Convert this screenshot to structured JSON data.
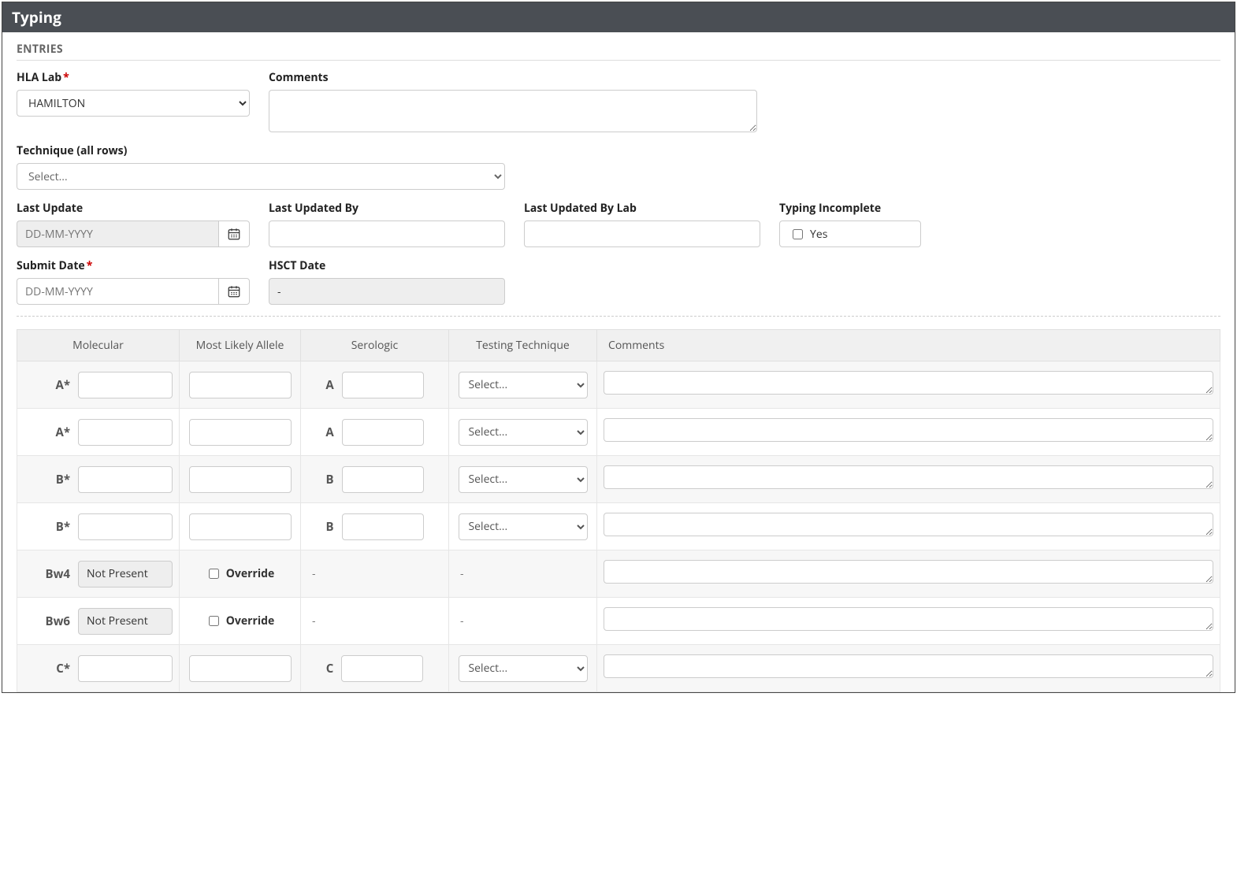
{
  "header": {
    "title": "Typing"
  },
  "section": {
    "entries": "ENTRIES"
  },
  "fields": {
    "hla_lab": {
      "label": "HLA Lab",
      "required": true,
      "value": "HAMILTON"
    },
    "comments": {
      "label": "Comments",
      "value": ""
    },
    "technique": {
      "label": "Technique (all rows)",
      "placeholder": "Select..."
    },
    "last_update": {
      "label": "Last Update",
      "placeholder": "DD-MM-YYYY",
      "value": ""
    },
    "last_updated_by": {
      "label": "Last Updated By",
      "value": ""
    },
    "last_updated_by_lab": {
      "label": "Last Updated By Lab",
      "value": ""
    },
    "typing_incomplete": {
      "label": "Typing Incomplete",
      "checkbox_label": "Yes",
      "checked": false
    },
    "submit_date": {
      "label": "Submit Date",
      "required": true,
      "placeholder": "DD-MM-YYYY",
      "value": ""
    },
    "hsct_date": {
      "label": "HSCT Date",
      "value": "-"
    }
  },
  "table": {
    "headers": {
      "molecular": "Molecular",
      "most_likely_allele": "Most Likely Allele",
      "serologic": "Serologic",
      "testing_technique": "Testing Technique",
      "comments": "Comments"
    },
    "tech_placeholder": "Select...",
    "not_present": "Not Present",
    "override_label": "Override",
    "dash": "-",
    "rows": [
      {
        "mol_label": "A*",
        "sero_label": "A",
        "type": "std",
        "shade": true
      },
      {
        "mol_label": "A*",
        "sero_label": "A",
        "type": "std",
        "shade": false
      },
      {
        "mol_label": "B*",
        "sero_label": "B",
        "type": "std",
        "shade": true
      },
      {
        "mol_label": "B*",
        "sero_label": "B",
        "type": "std",
        "shade": false
      },
      {
        "mol_label": "Bw4",
        "type": "bw",
        "shade": true
      },
      {
        "mol_label": "Bw6",
        "type": "bw",
        "shade": false
      },
      {
        "mol_label": "C*",
        "sero_label": "C",
        "type": "std",
        "shade": true
      }
    ]
  }
}
